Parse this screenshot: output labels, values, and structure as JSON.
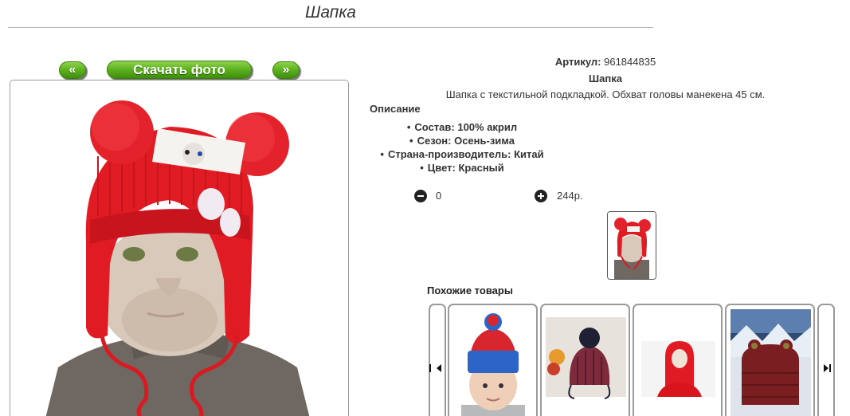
{
  "page": {
    "title": "Шапка"
  },
  "photo_nav": {
    "prev_label": "«",
    "download_label": "Скачать фото",
    "next_label": "»"
  },
  "product": {
    "sku_label": "Артикул:",
    "sku_value": "961844835",
    "name": "Шапка",
    "description": "Шапка с текстильной подкладкой. Обхват головы манекена 45 см.",
    "description_heading": "Описание",
    "attributes": [
      "Состав: 100% акрил",
      "Сезон: Осень-зима",
      "Страна-производитель: Китай",
      "Цвет: Красный"
    ],
    "color": "#e01b24"
  },
  "cart": {
    "quantity": "0",
    "price": "244р."
  },
  "similar": {
    "heading": "Похожие товары",
    "items": [
      {
        "image": "blue-red-beanie-boy"
      },
      {
        "image": "dark-knit-pompom-hat"
      },
      {
        "image": "red-balaclava"
      },
      {
        "image": "burgundy-frog-hat"
      }
    ]
  },
  "colors": {
    "accent_green": "#5cb01e",
    "hat_red": "#e01b24"
  }
}
